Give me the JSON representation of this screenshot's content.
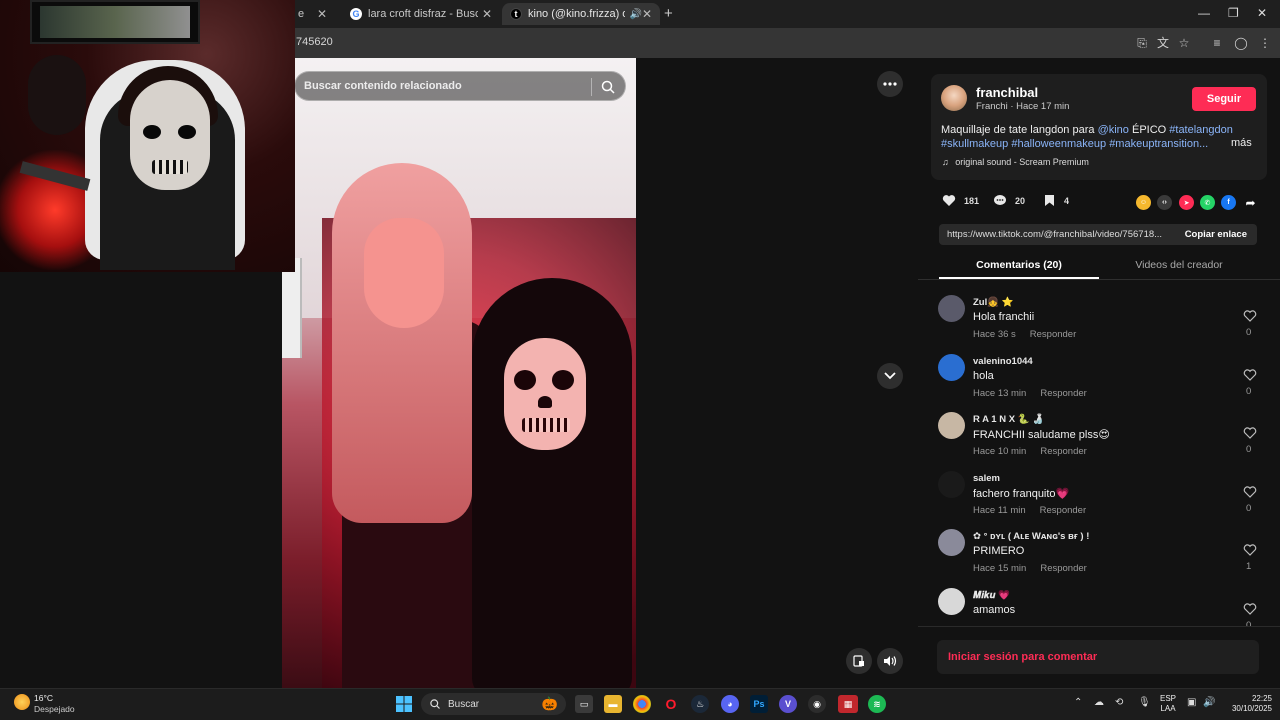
{
  "browser": {
    "tabs": [
      {
        "label": "e",
        "favicon": ""
      },
      {
        "label": "lara croft disfraz - Buscar con G",
        "favicon": "G"
      },
      {
        "label": "kino (@kino.frizza) oficial |",
        "favicon": "t"
      }
    ],
    "url_fragment": "745620"
  },
  "video": {
    "search_placeholder": "Buscar contenido relacionado"
  },
  "post": {
    "username": "franchibal",
    "subline": "Franchi · Hace 17 min",
    "follow_label": "Seguir",
    "desc_plain1": "Maquillaje de tate langdon para ",
    "mention": "@kino",
    "desc_plain2": " ÉPICO ",
    "tag1": "#tatelangdon",
    "tag2": "#skullmakeup",
    "tag3": "#halloweenmakeup",
    "tag4": "#makeuptransition...",
    "more": "más",
    "sound": "original sound - Scream Premium",
    "likes": "181",
    "comments": "20",
    "saves": "4",
    "link": "https://www.tiktok.com/@franchibal/video/756718...",
    "copy_label": "Copiar enlace",
    "accent": "#fe2c55"
  },
  "tabs": {
    "comments": "Comentarios (20)",
    "creator": "Videos del creador"
  },
  "comments": [
    {
      "user": "Zul👧 ⭐",
      "text": "Hola franchii",
      "time": "Hace 36 s",
      "reply": "Responder",
      "likes": "0",
      "avatar_color": "#5a5a6a"
    },
    {
      "user": "valenino1044",
      "text": "hola",
      "time": "Hace 13 min",
      "reply": "Responder",
      "likes": "0",
      "avatar_color": "#2a6ed1"
    },
    {
      "user": "R A 1 N X 🐍 🍶",
      "text": "FRANCHII saludame plss😍",
      "time": "Hace 10 min",
      "reply": "Responder",
      "likes": "0",
      "avatar_color": "#c7b7a4"
    },
    {
      "user": "salem",
      "text": "fachero franquito💗",
      "time": "Hace 11 min",
      "reply": "Responder",
      "likes": "0",
      "avatar_color": "#1a1a1a"
    },
    {
      "user": "✿ ° ᴅʏʟ ( Aʟᴇ Wᴀɴɢ's ʙғ ) !",
      "text": "PRIMERO",
      "time": "Hace 15 min",
      "reply": "Responder",
      "likes": "1",
      "avatar_color": "#8a8a9a"
    },
    {
      "user": "𝑴𝒊𝒌𝒖 💗",
      "text": "amamos",
      "time": "",
      "reply": "",
      "likes": "0",
      "avatar_color": "#d8d8d8"
    }
  ],
  "login_prompt": "Iniciar sesión para comentar",
  "taskbar": {
    "temp": "16°C",
    "weather": "Despejado",
    "search": "Buscar",
    "lang1": "ESP",
    "lang2": "LAA",
    "time": "22:25",
    "date": "30/10/2025"
  }
}
